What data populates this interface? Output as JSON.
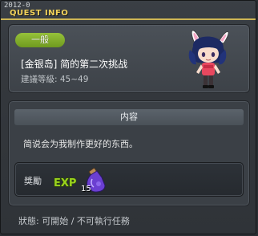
{
  "titlebar": {
    "year": "2012-0",
    "title": "QUEST INFO"
  },
  "quest": {
    "category_tag": "一般",
    "name": "[金银岛] 简的第二次挑战",
    "level_text": "建議等級: 45~49"
  },
  "content": {
    "section_title": "内容",
    "description": "简说会为我制作更好的东西。"
  },
  "reward": {
    "label": "獎勵",
    "exp_icon": "EXP",
    "item_icon": "purple-potion-icon",
    "item_count": "15"
  },
  "status": {
    "text": "狀態: 可開始 / 不可執行任務"
  },
  "colors": {
    "title_accent": "#f3d35a",
    "tag_green": "#86b02c",
    "panel_bg": "#3b4046"
  }
}
